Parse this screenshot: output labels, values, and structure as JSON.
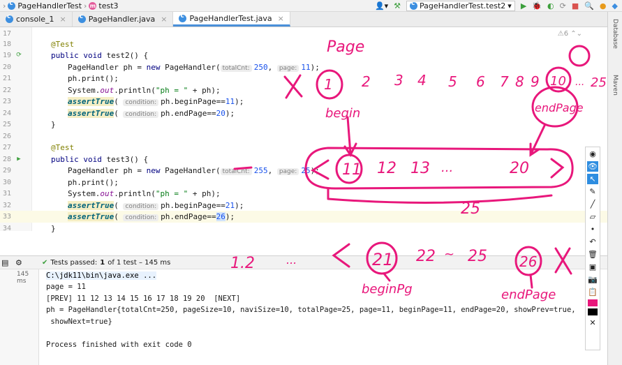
{
  "toolbar": {
    "breadcrumbs": [
      "PageHandlerTest",
      "test3"
    ],
    "run_config": "PageHandlerTest.test2"
  },
  "tabs": [
    {
      "label": "console_1",
      "active": false
    },
    {
      "label": "PageHandler.java",
      "active": false
    },
    {
      "label": "PageHandlerTest.java",
      "active": true
    }
  ],
  "editor": {
    "warning_count": "6",
    "lines": {
      "l17": "17",
      "l18": "18",
      "l19": "19",
      "l20": "20",
      "l21": "21",
      "l22": "22",
      "l23": "23",
      "l24": "24",
      "l25": "25",
      "l26": "26",
      "l27": "27",
      "l28": "28",
      "l29": "29",
      "l30": "30",
      "l31": "31",
      "l32": "32",
      "l33": "33",
      "l34": "34"
    },
    "test2": {
      "annotation": "@Test",
      "signature_kw": "public void ",
      "signature_name": "test2() {",
      "decl_a": "PageHandler ph = ",
      "new_kw": "new",
      "decl_b": " PageHandler(",
      "hint_total": "totalCnt:",
      "total": "250",
      "hint_page": "page:",
      "page": "11",
      "decl_end": ");",
      "print": "ph.print();",
      "sysout_a": "System.",
      "sysout_field": "out",
      "sysout_b": ".println(",
      "sysout_str": "\"ph = \"",
      "sysout_c": " + ph);",
      "assert": "assertTrue",
      "hint_cond": "condition:",
      "cond1": "ph.beginPage==",
      "cond1_val": "11",
      "cond2": "ph.endPage==",
      "cond2_val": "20",
      "close": ");",
      "brace": "}"
    },
    "test3": {
      "annotation": "@Test",
      "signature_name": "test3() {",
      "total": "255",
      "page": "25",
      "cond1_val": "21",
      "cond2_val": "26"
    }
  },
  "run": {
    "status": "Tests passed:",
    "count": "1",
    "of": "of 1 test – 145 ms",
    "time": "145 ms",
    "console": [
      "C:\\jdk11\\bin\\java.exe ...",
      "page = 11",
      "[PREV] 11 12 13 14 15 16 17 18 19 20  [NEXT]",
      "ph = PageHandler{totalCnt=250, pageSize=10, naviSize=10, totalPage=25, page=11, beginPage=11, endPage=20, showPrev=true,",
      " showNext=true}",
      "",
      "Process finished with exit code 0"
    ]
  },
  "side_labels": [
    "Database",
    "Maven"
  ],
  "ink": {
    "page": "Page",
    "row1": [
      "1",
      "2",
      "3",
      "4",
      "5",
      "6",
      "7",
      "8",
      "9",
      "10",
      "...",
      "25"
    ],
    "begin": "begin",
    "endpage": "endPage",
    "row2": [
      "11",
      "12",
      "13",
      "...",
      "20"
    ],
    "total": "25",
    "row3": [
      "1.2",
      "...",
      "21",
      "22",
      "~",
      "25",
      "26"
    ],
    "begin2": "beginPg",
    "endpage2": "endPage"
  },
  "colors": {
    "ink": "#e8177b",
    "accent": "#4a90d9"
  }
}
